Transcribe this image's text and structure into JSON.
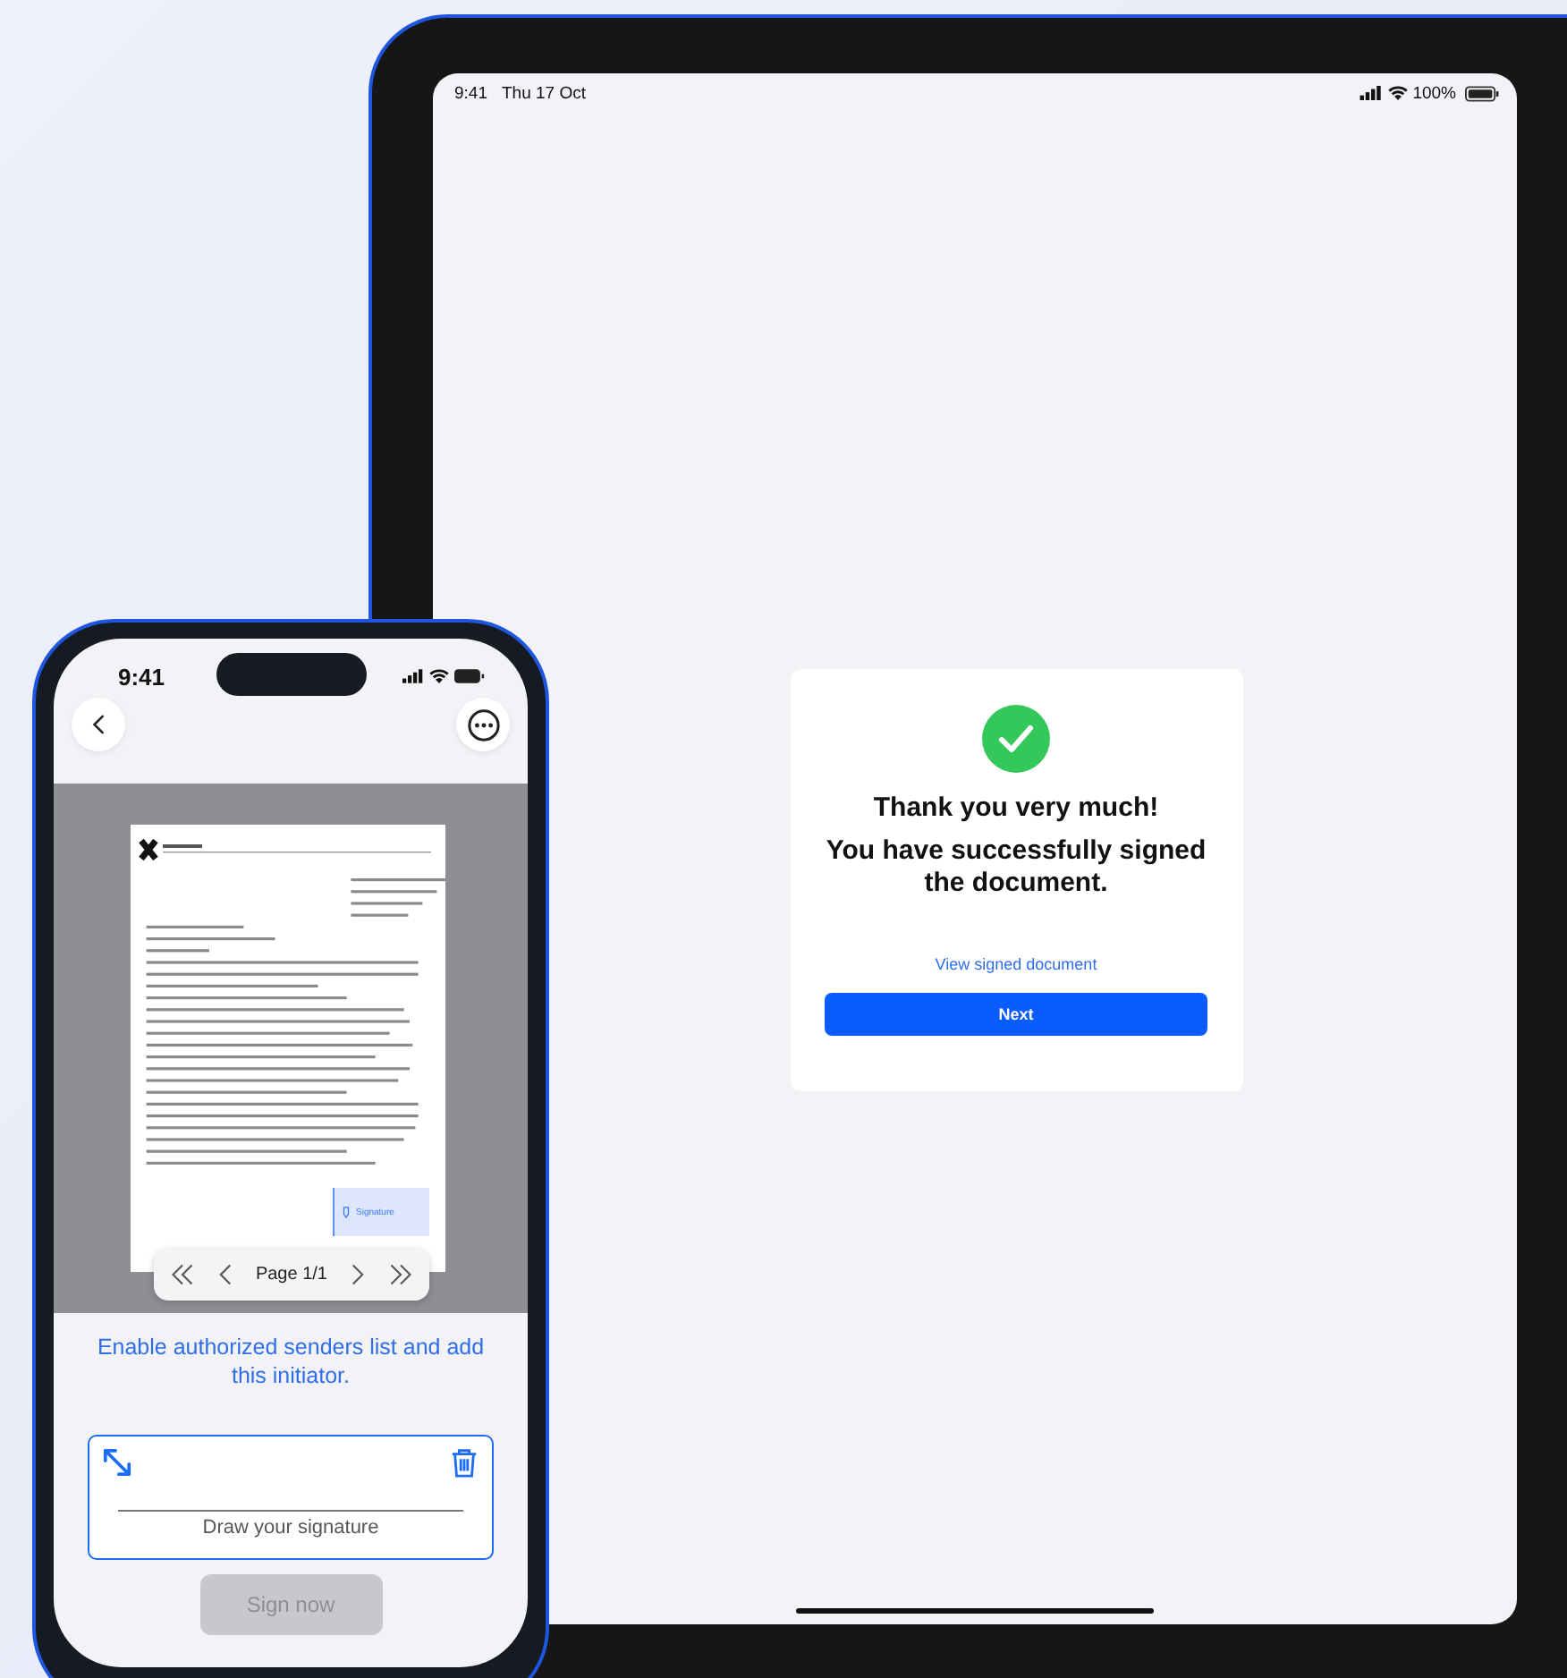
{
  "tablet": {
    "status_bar": {
      "time": "9:41",
      "date": "Thu 17 Oct",
      "battery": "100%"
    },
    "card": {
      "title": "Thank you very much!",
      "message": "You have successfully signed the document.",
      "link": "View signed document",
      "button": "Next"
    }
  },
  "phone": {
    "status_bar": {
      "time": "9:41"
    },
    "document": {
      "signature_field": "Signature",
      "pager": "Page 1/1"
    },
    "notice": "Enable authorized senders list and add this initiator.",
    "signature_pad": {
      "placeholder": "Draw your signature"
    },
    "sign_button": {
      "label": "Sign now",
      "disabled": true
    }
  }
}
